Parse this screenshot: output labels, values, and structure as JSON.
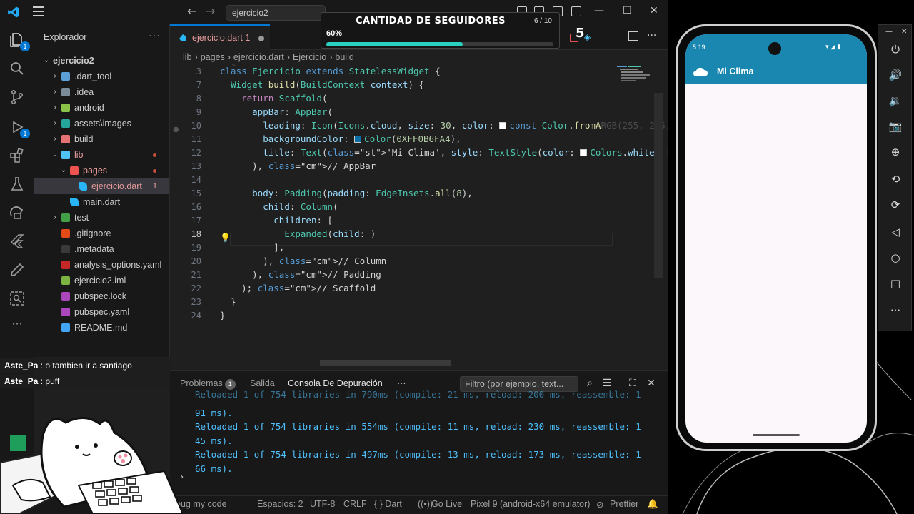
{
  "titlebar": {
    "search": "ejercicio2"
  },
  "activity_badges": {
    "explorer": "1",
    "debug": "1"
  },
  "sidebar": {
    "title": "Explorador",
    "more": "···",
    "items": [
      {
        "label": "ejercicio2",
        "depth": 0,
        "chev": "⌄",
        "kind": "root"
      },
      {
        "label": ".dart_tool",
        "depth": 1,
        "chev": "›",
        "kind": "folder",
        "color": "#5c9fd6"
      },
      {
        "label": ".idea",
        "depth": 1,
        "chev": "›",
        "kind": "folder",
        "color": "#7a8b99"
      },
      {
        "label": "android",
        "depth": 1,
        "chev": "›",
        "kind": "folder",
        "color": "#8bc34a"
      },
      {
        "label": "assets\\images",
        "depth": 1,
        "chev": "›",
        "kind": "folder",
        "color": "#26a69a"
      },
      {
        "label": "build",
        "depth": 1,
        "chev": "›",
        "kind": "folder",
        "color": "#e57373"
      },
      {
        "label": "lib",
        "depth": 1,
        "chev": "⌄",
        "kind": "folder",
        "color": "#4fc3f7",
        "dot": true,
        "red": true
      },
      {
        "label": "pages",
        "depth": 2,
        "chev": "⌄",
        "kind": "folder",
        "color": "#ef5350",
        "dot": true,
        "red": true
      },
      {
        "label": "ejercicio.dart",
        "depth": 3,
        "chev": "",
        "kind": "dart",
        "color": "#29b6f6",
        "active": true,
        "count": "1",
        "red": true
      },
      {
        "label": "main.dart",
        "depth": 2,
        "chev": "",
        "kind": "dart",
        "color": "#29b6f6"
      },
      {
        "label": "test",
        "depth": 1,
        "chev": "›",
        "kind": "folder",
        "color": "#43a047"
      },
      {
        "label": ".gitignore",
        "depth": 1,
        "chev": "",
        "kind": "file",
        "color": "#e64a19"
      },
      {
        "label": ".metadata",
        "depth": 1,
        "chev": "",
        "kind": "file",
        "color": "#3a3a3a"
      },
      {
        "label": "analysis_options.yaml",
        "depth": 1,
        "chev": "",
        "kind": "file",
        "color": "#c62828"
      },
      {
        "label": "ejercicio2.iml",
        "depth": 1,
        "chev": "",
        "kind": "file",
        "color": "#7cb342"
      },
      {
        "label": "pubspec.lock",
        "depth": 1,
        "chev": "",
        "kind": "file",
        "color": "#ab47bc"
      },
      {
        "label": "pubspec.yaml",
        "depth": 1,
        "chev": "",
        "kind": "file",
        "color": "#ab47bc"
      },
      {
        "label": "README.md",
        "depth": 1,
        "chev": "",
        "kind": "file",
        "color": "#42a5f5"
      }
    ]
  },
  "tab": {
    "label": "ejercicio.dart 1"
  },
  "breadcrumb": [
    "lib",
    "›",
    "pages",
    "›",
    "ejercicio.dart",
    "›",
    "Ejercicio",
    "›",
    "build"
  ],
  "editor": {
    "lines": [
      "3",
      "7",
      "8",
      "9",
      "10",
      "11",
      "12",
      "13",
      "14",
      "15",
      "16",
      "17",
      "18",
      "19",
      "20",
      "21",
      "22",
      "23",
      "24"
    ],
    "current_line": "18",
    "code": [
      "class Ejercicio extends StatelessWidget {",
      "  Widget build(BuildContext context) {",
      "    return Scaffold(",
      "      appBar: AppBar(",
      "        leading: Icon(Icons.cloud, size: 30, color: const Color.fromA",
      "        backgroundColor: Color(0XFF0B6FA4),",
      "        title: Text('Mi Clima', style: TextStyle(color: Colors.white",
      "      ), // AppBar",
      "",
      "      body: Padding(padding: EdgeInsets.all(8),",
      "        child: Column(",
      "          children: [",
      "            Expanded(child: )",
      "          ],",
      "        ), // Column",
      "      ), // Padding",
      "    ); // Scaffold",
      "  }",
      "}"
    ],
    "ghost": {
      "override": "@override",
      "rgb": "RGB(255, 255,",
      "fontweight": "fontWe"
    }
  },
  "panel": {
    "tabs": {
      "problems": "Problemas",
      "problems_count": "1",
      "output": "Salida",
      "debug_console": "Consola De Depuración",
      "more": "···"
    },
    "filter_placeholder": "Filtro (por ejemplo, text...",
    "output": [
      "Reloaded 1 of 754 libraries in 790ms (compile: 21 ms, reload: 200 ms, reassemble: 1",
      "91 ms).",
      "Reloaded 1 of 754 libraries in 554ms (compile: 11 ms, reload: 230 ms, reassemble: 1",
      "45 ms).",
      "Reloaded 1 of 754 libraries in 497ms (compile: 13 ms, reload: 173 ms, reassemble: 1",
      "66 ms)."
    ],
    "prompt": "›"
  },
  "statusbar": {
    "bug": "bug my code",
    "spaces": "Espacios: 2",
    "encoding": "UTF-8",
    "eol": "CRLF",
    "lang": "{ } Dart",
    "golive": "Go Live",
    "device": "Pixel 9 (android-x64 emulator)",
    "prettier": "Prettier"
  },
  "overlay": {
    "title": "CANTIDAD DE SEGUIDORES",
    "count": "6 / 10",
    "percent": "60%",
    "progress": 0.6,
    "big_number": "5"
  },
  "chat": [
    {
      "user": "Aste_Pa",
      "msg": "o tambien ir a santiago"
    },
    {
      "user": "Aste_Pa",
      "msg": "puff"
    }
  ],
  "phone": {
    "time": "5:19",
    "app_title": "Mi Clima",
    "bar_color": "#1a87b1"
  }
}
